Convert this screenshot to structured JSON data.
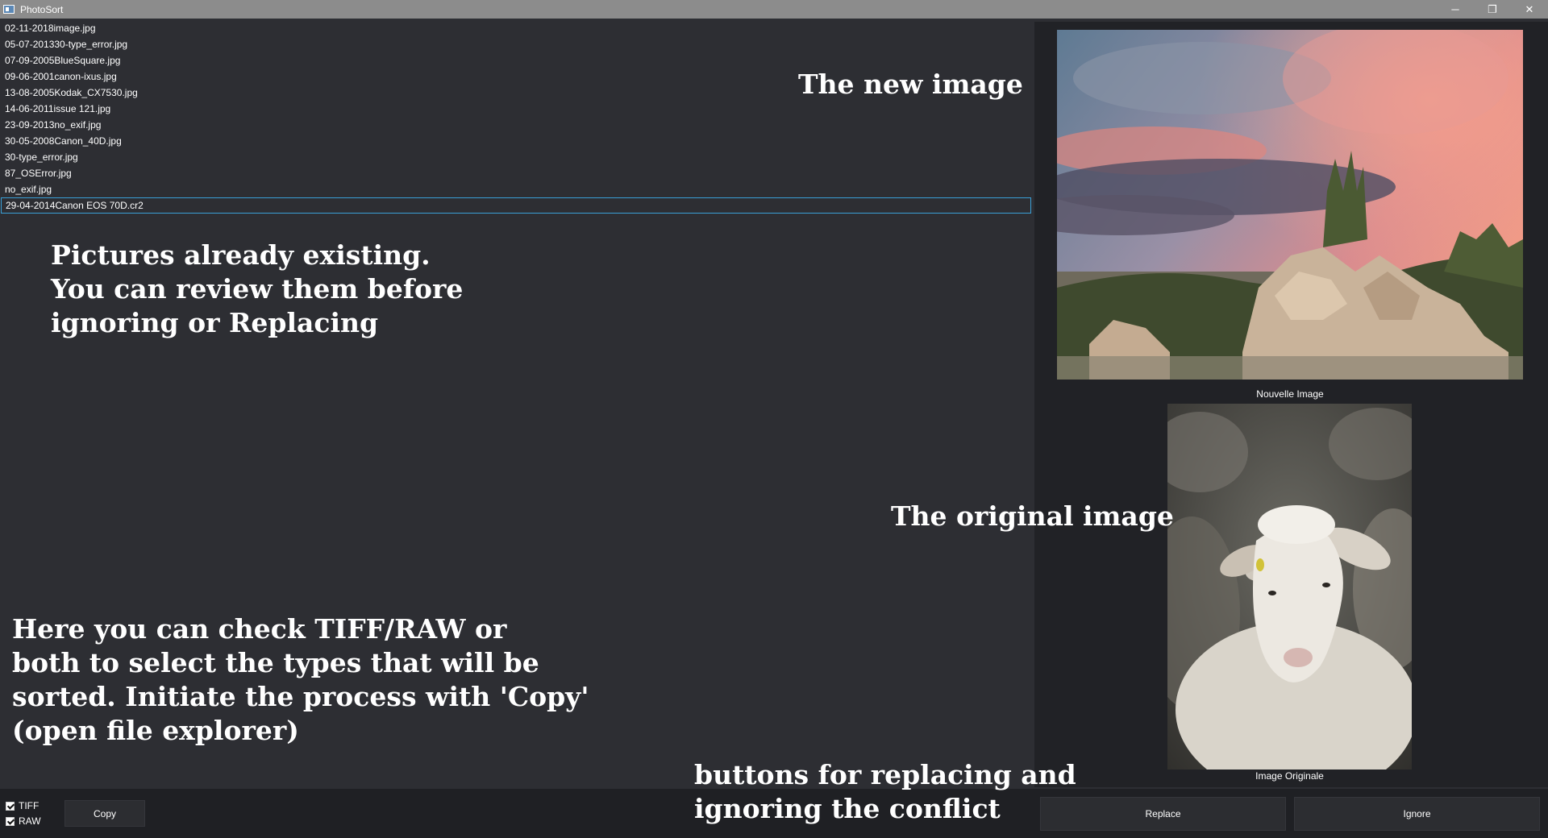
{
  "window": {
    "title": "PhotoSort",
    "minimize_glyph": "─",
    "restore_glyph": "❐",
    "close_glyph": "✕"
  },
  "files": [
    "02-11-2018image.jpg",
    "05-07-201330-type_error.jpg",
    "07-09-2005BlueSquare.jpg",
    "09-06-2001canon-ixus.jpg",
    "13-08-2005Kodak_CX7530.jpg",
    "14-06-2011issue 121.jpg",
    "23-09-2013no_exif.jpg",
    "30-05-2008Canon_40D.jpg",
    "30-type_error.jpg",
    "87_OSError.jpg",
    "no_exif.jpg",
    "29-04-2014Canon EOS 70D.cr2"
  ],
  "annotations": {
    "new_image": "The new image",
    "existing": "Pictures already existing.\nYou can review them before\nignoring or Replacing",
    "original_image": "The original image",
    "types_help": "Here you can check TIFF/RAW or\nboth to select the types that will be\nsorted. Initiate the process with 'Copy'\n(open file explorer)",
    "buttons_help": "buttons for replacing and\nignoring the conflict"
  },
  "preview": {
    "new_caption": "Nouvelle Image",
    "original_caption": "Image Originale"
  },
  "controls": {
    "tiff_label": "TIFF",
    "raw_label": "RAW",
    "copy_label": "Copy",
    "replace_label": "Replace",
    "ignore_label": "Ignore"
  }
}
